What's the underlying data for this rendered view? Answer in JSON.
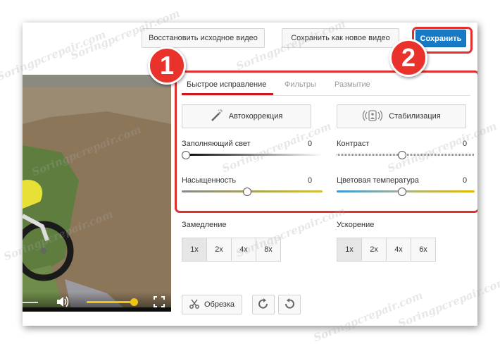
{
  "header": {
    "restore_label": "Восстановить исходное видео",
    "save_as_new_label": "Сохранить как новое видео",
    "save_label": "Сохранить"
  },
  "callouts": {
    "one": "1",
    "two": "2"
  },
  "tabs": [
    {
      "label": "Быстрое исправление",
      "active": true
    },
    {
      "label": "Фильтры",
      "active": false
    },
    {
      "label": "Размытие",
      "active": false
    }
  ],
  "quick_fix": {
    "auto_label": "Автокоррекция",
    "stabilize_label": "Стабилизация",
    "fill_light": {
      "label": "Заполняющий свет",
      "value": "0",
      "level": 0
    },
    "contrast": {
      "label": "Контраст",
      "value": "0",
      "level": 0.5
    },
    "saturation": {
      "label": "Насыщенность",
      "value": "0",
      "level": 0.5
    },
    "color_temp": {
      "label": "Цветовая температура",
      "value": "0",
      "level": 0.5
    }
  },
  "slowmo": {
    "label": "Замедление",
    "options": [
      "1x",
      "2x",
      "4x",
      "8x"
    ],
    "selected": "1x"
  },
  "timelapse": {
    "label": "Ускорение",
    "options": [
      "1x",
      "2x",
      "4x",
      "6x"
    ],
    "selected": "1x"
  },
  "bottom": {
    "trim_label": "Обрезка"
  },
  "player": {
    "volume_level": 0.95
  },
  "watermark_text": "Soringpcrepair.com",
  "colors": {
    "accent_red": "#e0312f",
    "primary_blue": "#167ac6",
    "slider_yellow": "#f1c40f",
    "slider_blue": "#3d9ad9"
  }
}
